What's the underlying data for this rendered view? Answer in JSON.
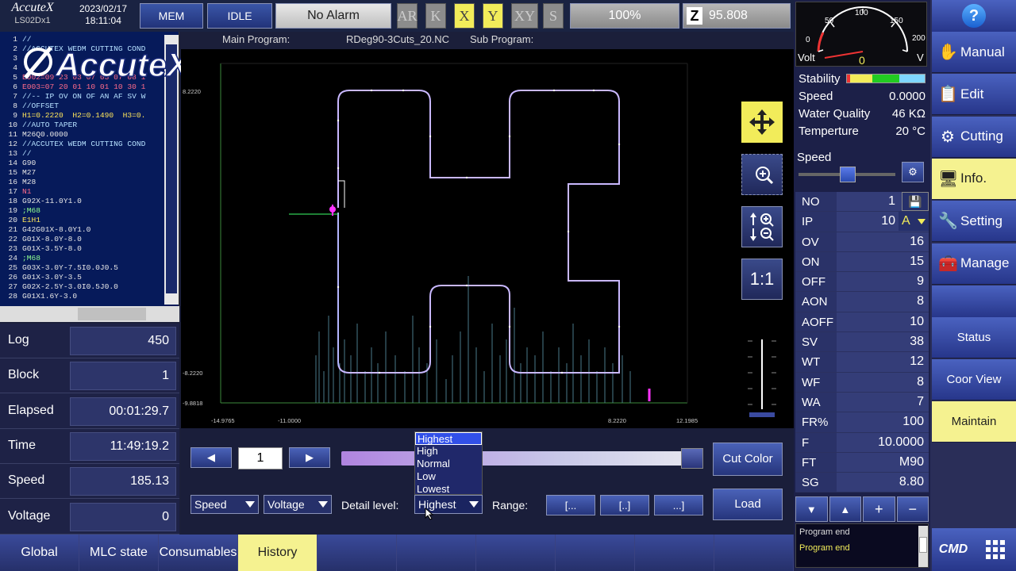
{
  "header": {
    "brand": "AccuteX",
    "model": "LS02Dx1",
    "date": "2023/02/17",
    "time": "18:11:04",
    "mem": "MEM",
    "idle": "IDLE",
    "alarm": "No Alarm",
    "axes": [
      "AR",
      "K",
      "X",
      "Y",
      "XY",
      "S"
    ],
    "axes_on": [
      "X",
      "Y"
    ],
    "pct": "100%",
    "z_label": "Z",
    "z_value": "95.808"
  },
  "code": {
    "lines": [
      {
        "n": "1",
        "t": "//",
        "c": "cm"
      },
      {
        "n": "2",
        "t": "//ACCUTEX WEDM CUTTING COND",
        "c": "cm"
      },
      {
        "n": "3",
        "t": "",
        "c": "cm"
      },
      {
        "n": "4",
        "t": "",
        "c": "cm"
      },
      {
        "n": "5",
        "t": "E002=09 23 03 07 03 07 08 1",
        "c": "cr"
      },
      {
        "n": "6",
        "t": "E003=07 20 01 10 01 10 30 1",
        "c": "cr"
      },
      {
        "n": "7",
        "t": "//-- IP OV ON OF AN AF SV W",
        "c": "cm"
      },
      {
        "n": "8",
        "t": "//OFFSET",
        "c": "cm"
      },
      {
        "n": "9",
        "t": "H1=0.2220  H2=0.1490  H3=0.",
        "c": "cy"
      },
      {
        "n": "10",
        "t": "//AUTO TAPER",
        "c": "cm"
      },
      {
        "n": "11",
        "t": "M26Q0.0000",
        "c": ""
      },
      {
        "n": "12",
        "t": "//ACCUTEX WEDM CUTTING COND",
        "c": "cm"
      },
      {
        "n": "13",
        "t": "//",
        "c": "cm"
      },
      {
        "n": "14",
        "t": "G90",
        "c": ""
      },
      {
        "n": "15",
        "t": "M27",
        "c": ""
      },
      {
        "n": "16",
        "t": "M28",
        "c": ""
      },
      {
        "n": "17",
        "t": "N1",
        "c": "cr"
      },
      {
        "n": "18",
        "t": "G92X-11.0Y1.0",
        "c": ""
      },
      {
        "n": "19",
        "t": ";M68",
        "c": "cg"
      },
      {
        "n": "20",
        "t": "E1H1",
        "c": "cy"
      },
      {
        "n": "21",
        "t": "G42G01X-8.0Y1.0",
        "c": ""
      },
      {
        "n": "22",
        "t": "G01X-8.0Y-8.0",
        "c": ""
      },
      {
        "n": "23",
        "t": "G01X-3.5Y-8.0",
        "c": ""
      },
      {
        "n": "24",
        "t": ";M68",
        "c": "cg"
      },
      {
        "n": "25",
        "t": "G03X-3.0Y-7.5I0.0J0.5",
        "c": ""
      },
      {
        "n": "26",
        "t": "G01X-3.0Y-3.5",
        "c": ""
      },
      {
        "n": "27",
        "t": "G02X-2.5Y-3.0I0.5J0.0",
        "c": ""
      },
      {
        "n": "28",
        "t": "G01X1.6Y-3.0",
        "c": ""
      }
    ]
  },
  "stats": [
    {
      "label": "Log",
      "value": "450"
    },
    {
      "label": "Block",
      "value": "1"
    },
    {
      "label": "Elapsed",
      "value": "00:01:29.7"
    },
    {
      "label": "Time",
      "value": "11:49:19.2"
    },
    {
      "label": "Speed",
      "value": "185.13"
    },
    {
      "label": "Voltage",
      "value": "0"
    }
  ],
  "main": {
    "main_program_label": "Main Program:",
    "program": "RDeg90-3Cuts_20.NC",
    "sub_program_label": "Sub Program:"
  },
  "plot": {
    "y_top": "8.2220",
    "y_mid": "-8.2220",
    "y_bot": "-9.8818",
    "x_ticks": [
      "-14.9765",
      "-11.0000",
      "8.2220",
      "12.1985"
    ]
  },
  "tools": {
    "fit": "1:1"
  },
  "controls": {
    "page": "1",
    "cut_color": "Cut Color",
    "load": "Load",
    "sel1": "Speed",
    "sel2": "Voltage",
    "detail_label": "Detail level:",
    "detail_value": "Highest",
    "range_label": "Range:",
    "range_btns": [
      "[...",
      "[..]",
      "...]"
    ],
    "options": [
      "Highest",
      "High",
      "Normal",
      "Low",
      "Lowest"
    ]
  },
  "tabs": [
    "Global",
    "MLC state",
    "Consumables",
    "History",
    "",
    "",
    "",
    "",
    "",
    ""
  ],
  "active_tab": "History",
  "meter": {
    "ticks": [
      "0",
      "50",
      "100",
      "150",
      "200"
    ],
    "unit_left": "Volt",
    "value": "0",
    "unit_right": "V"
  },
  "info": [
    {
      "k": "Stability",
      "v": ""
    },
    {
      "k": "Speed",
      "v": "0.0000"
    },
    {
      "k": "Water Quality",
      "v": "46 KΩ"
    },
    {
      "k": "Temperture",
      "v": "20  °C"
    }
  ],
  "speed_label": "Speed",
  "params": [
    {
      "k": "NO",
      "v": "1"
    },
    {
      "k": "IP",
      "v": "10"
    },
    {
      "k": "OV",
      "v": "16"
    },
    {
      "k": "ON",
      "v": "15"
    },
    {
      "k": "OFF",
      "v": "9"
    },
    {
      "k": "AON",
      "v": "8"
    },
    {
      "k": "AOFF",
      "v": "10"
    },
    {
      "k": "SV",
      "v": "38"
    },
    {
      "k": "WT",
      "v": "12"
    },
    {
      "k": "WF",
      "v": "8"
    },
    {
      "k": "WA",
      "v": "7"
    },
    {
      "k": "FR%",
      "v": "100"
    },
    {
      "k": "F",
      "v": "10.0000"
    },
    {
      "k": "FT",
      "v": "M90"
    },
    {
      "k": "SG",
      "v": "8.80"
    }
  ],
  "ip_mode": "A",
  "log": [
    "Program end",
    "Program end"
  ],
  "nav": [
    {
      "label": "Manual",
      "icon": "hand-icon"
    },
    {
      "label": "Edit",
      "icon": "edit-icon"
    },
    {
      "label": "Cutting",
      "icon": "cutting-icon"
    },
    {
      "label": "Info.",
      "icon": "info-icon"
    },
    {
      "label": "Setting",
      "icon": "setting-icon"
    },
    {
      "label": "Manage",
      "icon": "manage-icon"
    },
    {
      "label": "Status"
    },
    {
      "label": "Coor View"
    },
    {
      "label": "Maintain"
    }
  ],
  "nav_active": [
    "Info.",
    "Maintain"
  ],
  "colors": {
    "yellow": "#f5f290",
    "blue": "#27368a",
    "accent": "#f2ec5a"
  }
}
